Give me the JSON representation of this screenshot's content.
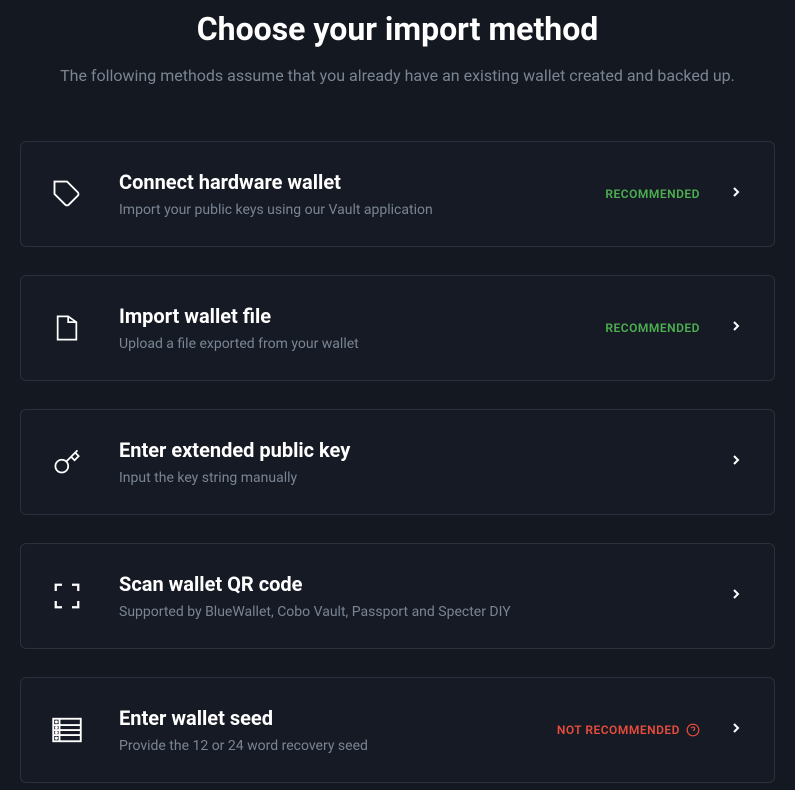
{
  "page": {
    "title": "Choose your import method",
    "subtitle": "The following methods assume that you already have an existing wallet created and backed up."
  },
  "badges": {
    "recommended": "RECOMMENDED",
    "not_recommended": "NOT RECOMMENDED"
  },
  "options": [
    {
      "title": "Connect hardware wallet",
      "description": "Import your public keys using our Vault application",
      "badge": "recommended"
    },
    {
      "title": "Import wallet file",
      "description": "Upload a file exported from your wallet",
      "badge": "recommended"
    },
    {
      "title": "Enter extended public key",
      "description": "Input the key string manually",
      "badge": null
    },
    {
      "title": "Scan wallet QR code",
      "description": "Supported by BlueWallet, Cobo Vault, Passport and Specter DIY",
      "badge": null
    },
    {
      "title": "Enter wallet seed",
      "description": "Provide the 12 or 24 word recovery seed",
      "badge": "not_recommended"
    }
  ]
}
